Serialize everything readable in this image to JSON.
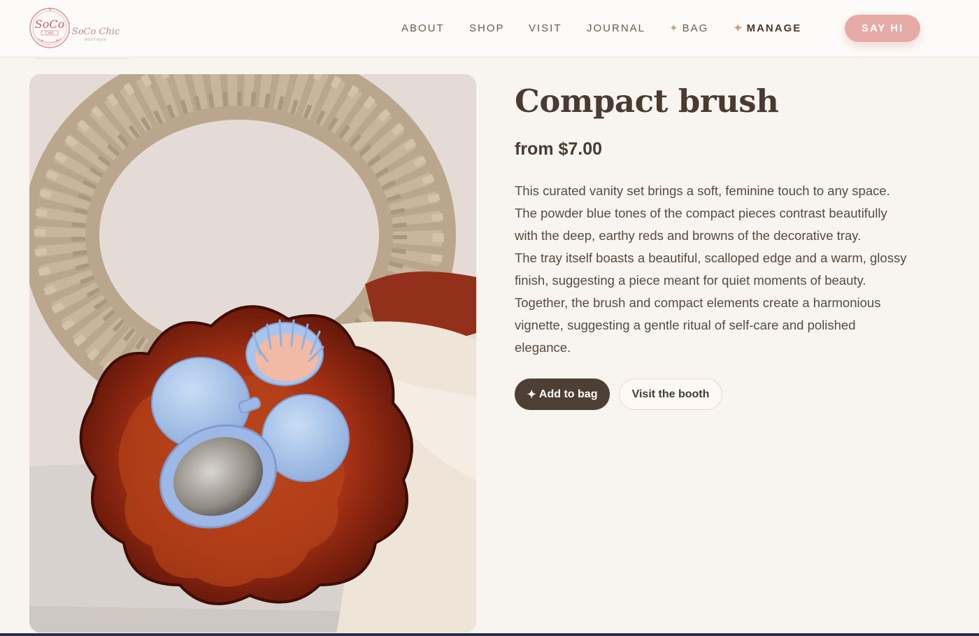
{
  "brand": {
    "logo_text": "SoCo",
    "logo_sub": "CHIC",
    "logo_small": "BOUTIQUE",
    "wordmark": "SoCo Chic",
    "wordmark_sub": "BOUTIQUE",
    "accent_color": "#e8aaa7",
    "dark_color": "#4d3f34"
  },
  "nav": {
    "items": [
      {
        "label": "ABOUT"
      },
      {
        "label": "SHOP"
      },
      {
        "label": "VISIT"
      },
      {
        "label": "JOURNAL"
      },
      {
        "label": "BAG",
        "icon": "sparkle-icon"
      },
      {
        "label": "MANAGE",
        "icon": "sparkle-icon"
      }
    ],
    "cta_label": "SAY HI"
  },
  "product": {
    "image_alt": "Compact brush and mirror set in a red scalloped glass tray",
    "title": "Compact brush",
    "price": "from $7.00",
    "description_lines": [
      "This curated vanity set brings a soft, feminine touch to any space.",
      "The powder blue tones of the compact pieces contrast beautifully",
      "with the deep, earthy reds and browns of the decorative tray.",
      "The tray itself boasts a beautiful, scalloped edge and a warm, glossy",
      "finish, suggesting a piece meant for quiet moments of beauty.",
      "Together, the brush and compact elements create a harmonious",
      "vignette, suggesting a gentle ritual of self-care and polished",
      "elegance."
    ],
    "add_button_icon": "✦",
    "add_button_label": "Add to bag",
    "visit_button_label": "Visit the booth"
  }
}
